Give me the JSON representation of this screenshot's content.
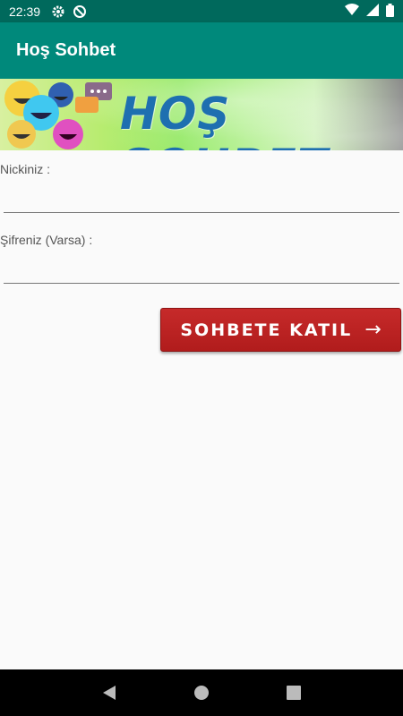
{
  "status_bar": {
    "time": "22:39",
    "icons": [
      "gear-icon",
      "do-not-disturb-icon",
      "wifi-icon",
      "signal-icon",
      "battery-icon"
    ]
  },
  "app_bar": {
    "title": "Hoş Sohbet"
  },
  "banner": {
    "text": "HOŞ SOHBET"
  },
  "form": {
    "nickname_label": "Nickiniz :",
    "nickname_value": "",
    "password_label": "Şifreniz (Varsa) :",
    "password_value": ""
  },
  "join_button": {
    "label": "SOHBETE KATIL",
    "arrow": "→"
  },
  "nav_bar": {
    "icons": [
      "back-icon",
      "home-icon",
      "recents-icon"
    ]
  },
  "colors": {
    "status_bar": "#00695c",
    "app_bar": "#00897b",
    "button": "#b11c1c",
    "banner_text": "#1e6fb0"
  }
}
